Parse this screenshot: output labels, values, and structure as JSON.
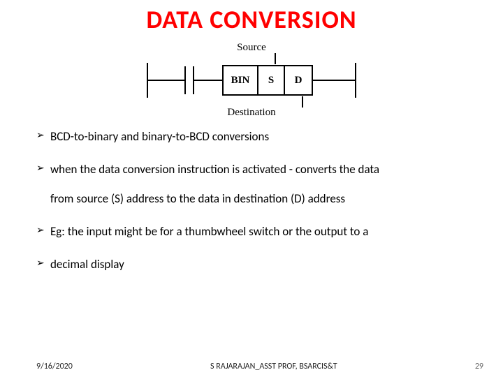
{
  "title": "DATA CONVERSION",
  "diagram": {
    "source_label": "Source",
    "destination_label": "Destination",
    "cells": {
      "bin": "BIN",
      "s": "S",
      "d": "D"
    }
  },
  "bullets": {
    "b1": "BCD-to-binary and binary-to-BCD conversions",
    "b2_line1": "when the data conversion instruction is activated -  converts the data",
    "b2_line2": "from source (S) address to the data in destination (D) address",
    "b3": "Eg: the input might be for a thumbwheel switch or the output to a",
    "b4": "decimal display"
  },
  "footer": {
    "date": "9/16/2020",
    "author": "S RAJARAJAN_ASST PROF, BSARCIS&T",
    "page": "29"
  }
}
